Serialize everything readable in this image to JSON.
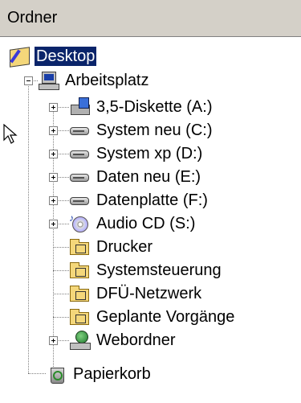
{
  "header": {
    "title": "Ordner"
  },
  "tree": {
    "desktop": {
      "label": "Desktop",
      "icon": "desktop-icon"
    },
    "arbeitsplatz": {
      "label": "Arbeitsplatz",
      "icon": "computer-icon"
    },
    "items": [
      {
        "label": "3,5-Diskette (A:)",
        "icon": "floppy-drive-icon",
        "expandable": true
      },
      {
        "label": "System neu (C:)",
        "icon": "hard-drive-icon",
        "expandable": true
      },
      {
        "label": "System xp (D:)",
        "icon": "hard-drive-icon",
        "expandable": true
      },
      {
        "label": "Daten neu (E:)",
        "icon": "hard-drive-icon",
        "expandable": true
      },
      {
        "label": "Datenplatte (F:)",
        "icon": "hard-drive-icon",
        "expandable": true
      },
      {
        "label": "Audio CD (S:)",
        "icon": "cd-drive-icon",
        "expandable": true
      },
      {
        "label": "Drucker",
        "icon": "printer-folder-icon",
        "expandable": false
      },
      {
        "label": "Systemsteuerung",
        "icon": "control-panel-folder-icon",
        "expandable": false
      },
      {
        "label": "DFÜ-Netzwerk",
        "icon": "dialup-folder-icon",
        "expandable": false
      },
      {
        "label": "Geplante Vorgänge",
        "icon": "scheduled-tasks-folder-icon",
        "expandable": false
      },
      {
        "label": "Webordner",
        "icon": "web-folders-icon",
        "expandable": true
      }
    ],
    "papierkorb": {
      "label": "Papierkorb",
      "icon": "recycle-bin-icon"
    }
  },
  "colors": {
    "selection": "#0a246a",
    "header_bg": "#d4d0c8"
  }
}
